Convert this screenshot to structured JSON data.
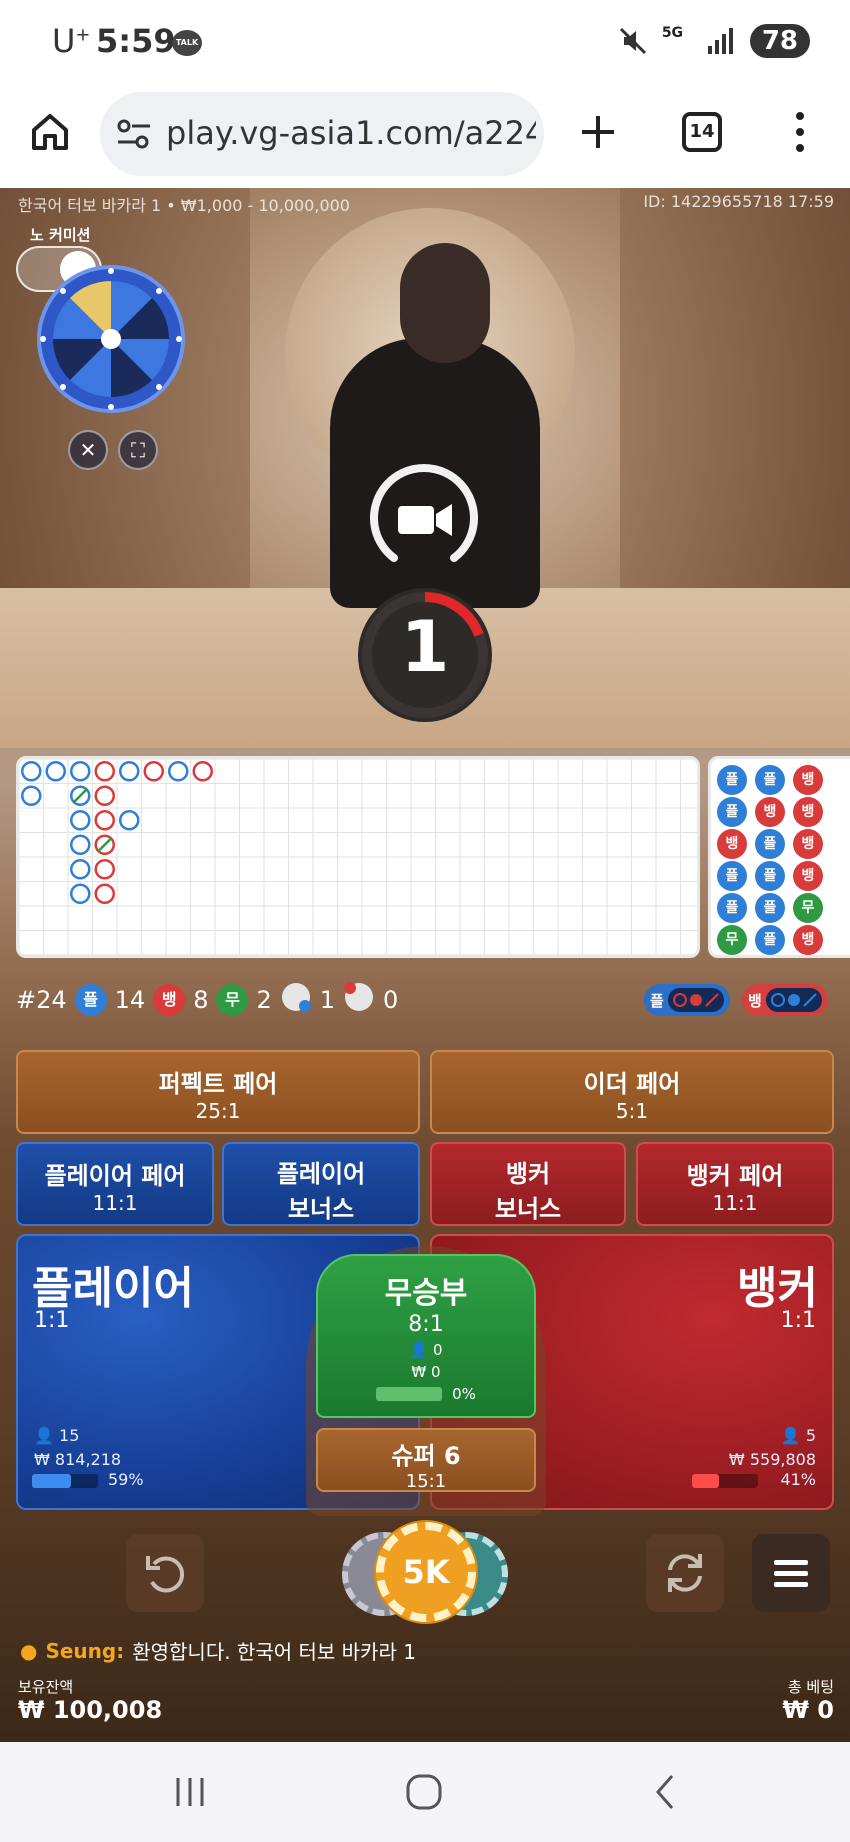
{
  "status_bar": {
    "carrier": "U",
    "carrier_sup": "+",
    "time": "5:59",
    "talk_badge": "TALK",
    "network": "5G",
    "battery": "78"
  },
  "browser": {
    "url": "play.vg-asia1.com/a224b",
    "tab_count": "14"
  },
  "game": {
    "table_info": "한국어 터보 바카라 1 • ₩1,000 - 10,000,000",
    "round_id": "ID: 14229655718 17:59",
    "no_commission_label": "노 커미션",
    "timer": "1"
  },
  "stats": {
    "round": "#24",
    "player_badge": "플",
    "player_count": "14",
    "banker_badge": "뱅",
    "banker_count": "8",
    "tie_badge": "무",
    "tie_count": "2",
    "player_pair_count": "1",
    "banker_pair_count": "0",
    "player_predict": "플",
    "banker_predict": "뱅"
  },
  "bets": {
    "perfect_pair": {
      "label": "퍼펙트 페어",
      "odds": "25:1"
    },
    "either_pair": {
      "label": "이더 페어",
      "odds": "5:1"
    },
    "player_pair": {
      "label": "플레이어 페어",
      "odds": "11:1"
    },
    "player_bonus": {
      "label1": "플레이어",
      "label2": "보너스"
    },
    "banker_bonus": {
      "label1": "뱅커",
      "label2": "보너스"
    },
    "banker_pair": {
      "label": "뱅커 페어",
      "odds": "11:1"
    },
    "player": {
      "label": "플레이어",
      "odds": "1:1",
      "players": "15",
      "amount": "₩ 814,218",
      "percent": "59%",
      "fraction": 0.59
    },
    "banker": {
      "label": "뱅커",
      "odds": "1:1",
      "players": "5",
      "amount": "₩ 559,808",
      "percent": "41%",
      "fraction": 0.41
    },
    "tie": {
      "label": "무승부",
      "odds": "8:1",
      "players": "0",
      "amount": "₩ 0",
      "percent": "0%",
      "fraction": 0.0
    },
    "super6": {
      "label": "슈퍼 6",
      "odds": "15:1"
    }
  },
  "chips": {
    "left": "1",
    "selected": "5K",
    "right": "K"
  },
  "chat": {
    "user": "Seung:",
    "message": "환영합니다. 한국어 터보 바카라 1"
  },
  "footer": {
    "balance_label": "보유잔액",
    "balance": "₩ 100,008",
    "total_bet_label": "총 베팅",
    "total_bet": "₩ 0"
  },
  "colors": {
    "player": "#2f7fd6",
    "banker": "#d93a3a",
    "tie": "#2f9a43",
    "chip_selected": "#f0a020"
  },
  "big_road": {
    "columns": [
      [
        "P",
        "P"
      ],
      [
        "P",
        "P-tie",
        "P",
        "P",
        "P",
        "P"
      ],
      [
        "B",
        "B",
        "B-tie",
        "B",
        "B"
      ],
      [
        "B",
        "P"
      ],
      [
        "P"
      ],
      [
        "B"
      ],
      [
        "P"
      ],
      [
        "B"
      ]
    ]
  },
  "bead_road": {
    "col1": [
      "플",
      "플",
      "뱅",
      "플",
      "플",
      "무"
    ],
    "col2": [
      "플",
      "뱅",
      "플",
      "플",
      "플",
      "플"
    ],
    "col3": [
      "뱅",
      "뱅",
      "뱅",
      "뱅",
      "무",
      "뱅"
    ]
  }
}
